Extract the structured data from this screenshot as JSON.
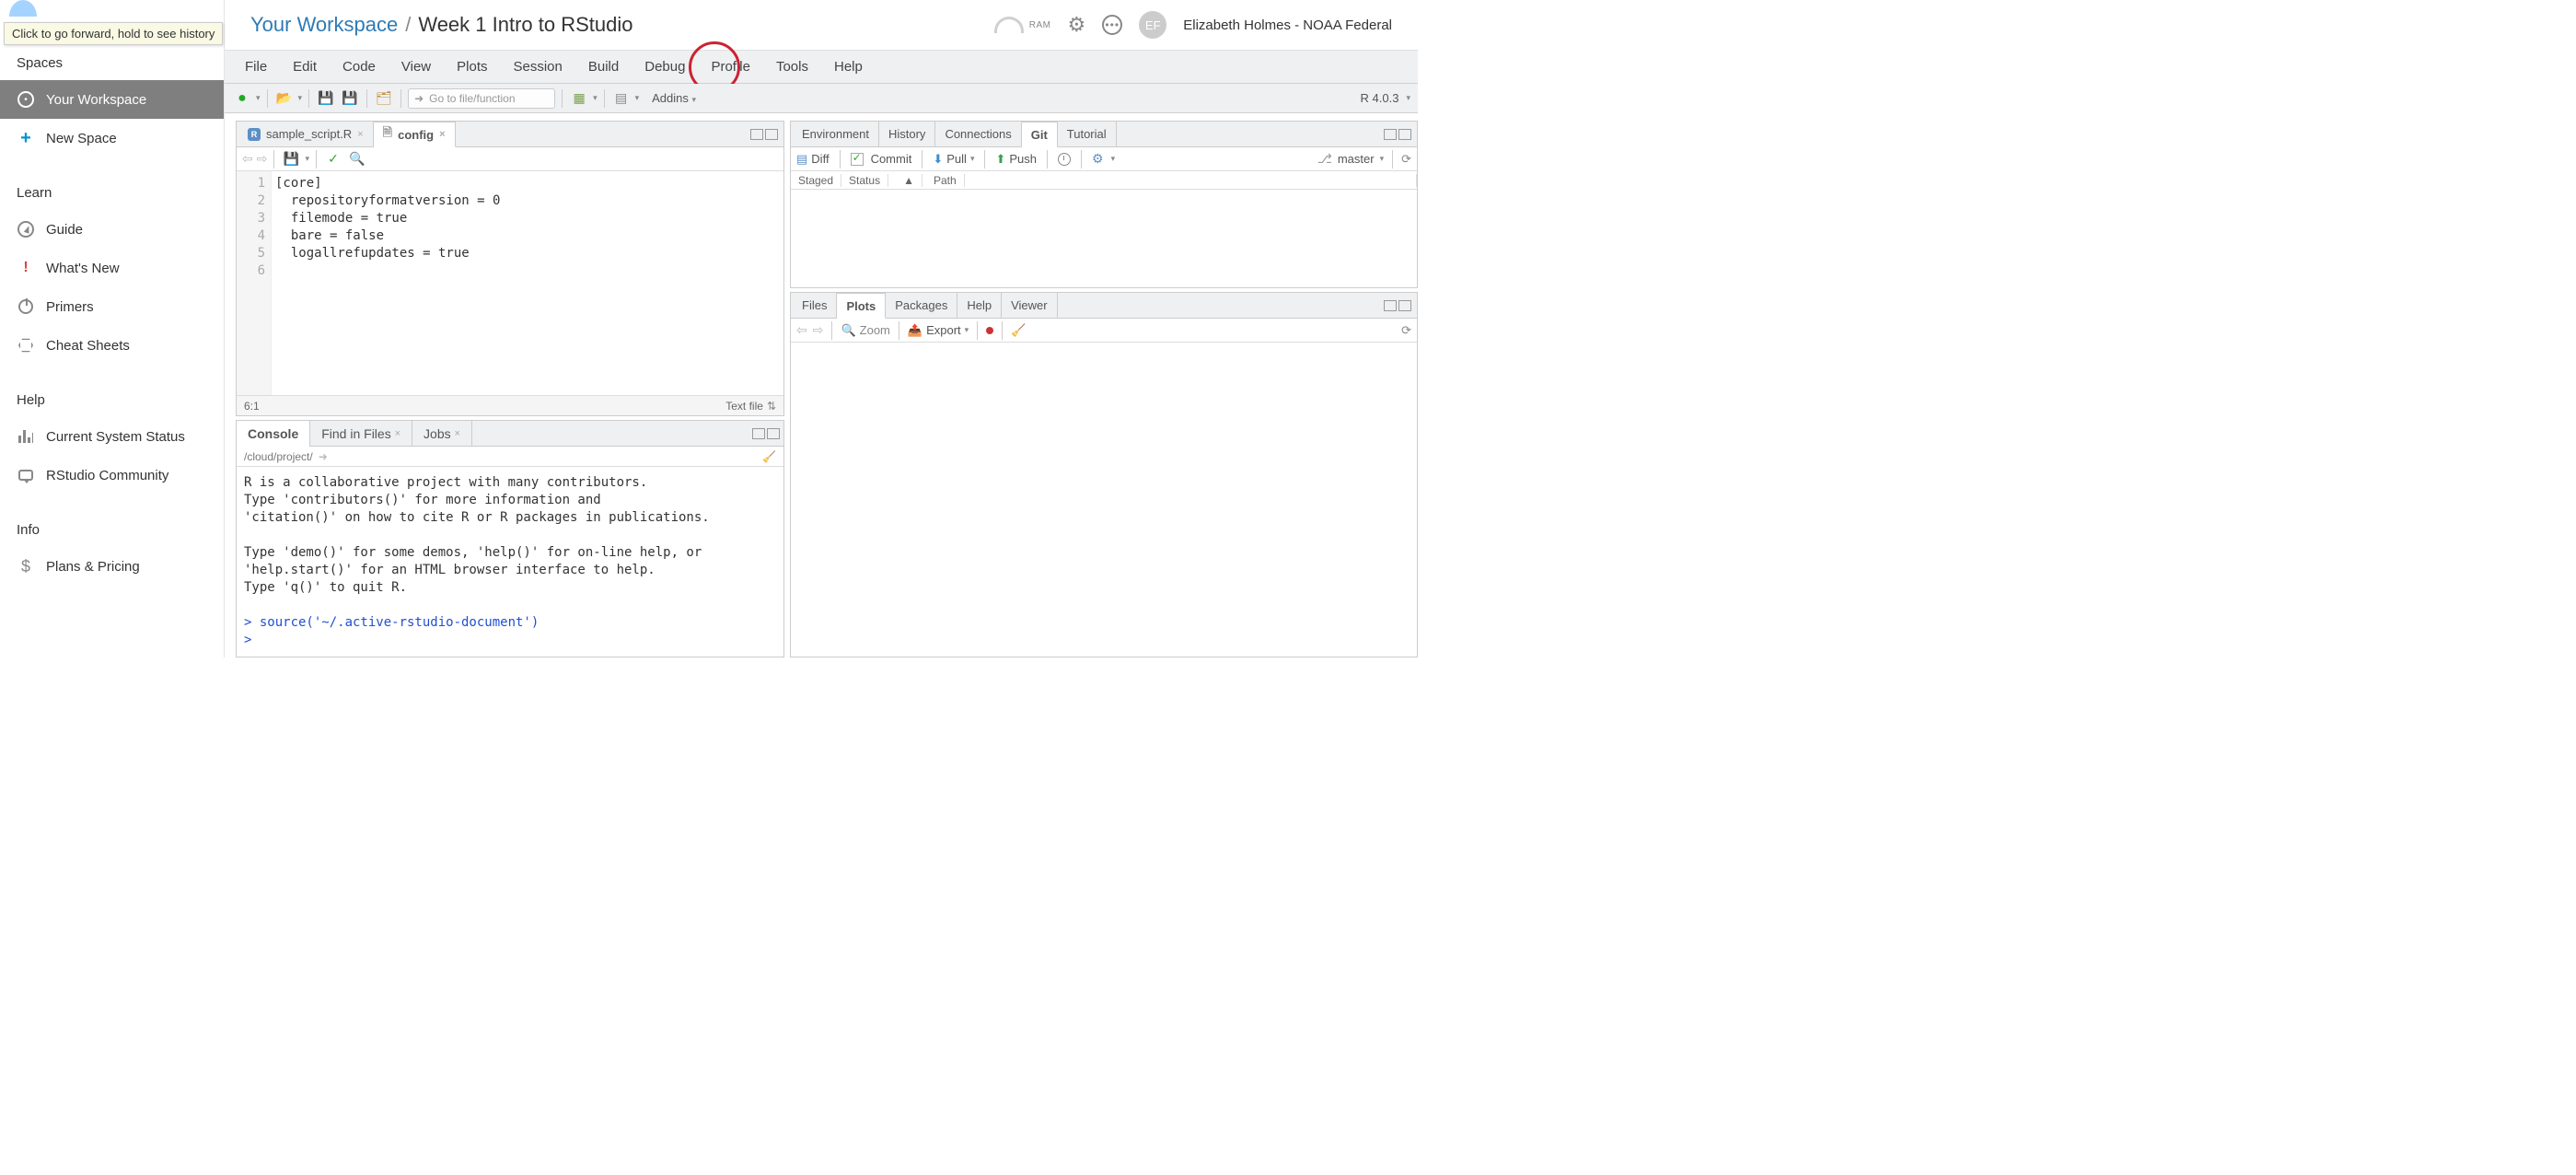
{
  "browser_tooltip": "Click to go forward, hold to see history",
  "sidebar": {
    "headings": {
      "spaces": "Spaces",
      "learn": "Learn",
      "help": "Help",
      "info": "Info"
    },
    "your_workspace": "Your Workspace",
    "new_space": "New Space",
    "guide": "Guide",
    "whats_new": "What's New",
    "primers": "Primers",
    "cheat_sheets": "Cheat Sheets",
    "system_status": "Current System Status",
    "community": "RStudio Community",
    "plans": "Plans & Pricing"
  },
  "breadcrumb": {
    "workspace": "Your Workspace",
    "project": "Week 1 Intro to RStudio"
  },
  "top_right": {
    "ram": "RAM",
    "user_initials": "EF",
    "user_name": "Elizabeth Holmes - NOAA Federal"
  },
  "menu": {
    "file": "File",
    "edit": "Edit",
    "code": "Code",
    "view": "View",
    "plots": "Plots",
    "session": "Session",
    "build": "Build",
    "debug": "Debug",
    "profile": "Profile",
    "tools": "Tools",
    "help": "Help"
  },
  "toolbar": {
    "goto_placeholder": "Go to file/function",
    "addins": "Addins",
    "r_version": "R 4.0.3"
  },
  "source": {
    "tabs": {
      "script": "sample_script.R",
      "config": "config"
    },
    "lines": [
      "1",
      "2",
      "3",
      "4",
      "5",
      "6"
    ],
    "code": "[core]\n  repositoryformatversion = 0\n  filemode = true\n  bare = false\n  logallrefupdates = true\n",
    "cursor": "6:1",
    "filetype": "Text file"
  },
  "console": {
    "tabs": {
      "console": "Console",
      "find": "Find in Files",
      "jobs": "Jobs"
    },
    "path": "/cloud/project/",
    "body_plain": "R is a collaborative project with many contributors.\nType 'contributors()' for more information and\n'citation()' on how to cite R or R packages in publications.\n\nType 'demo()' for some demos, 'help()' for on-line help, or\n'help.start()' for an HTML browser interface to help.\nType 'q()' to quit R.\n",
    "cmd": "> source('~/.active-rstudio-document')",
    "prompt": "> "
  },
  "env_pane": {
    "tabs": {
      "env": "Environment",
      "hist": "History",
      "conn": "Connections",
      "git": "Git",
      "tut": "Tutorial"
    },
    "git": {
      "diff": "Diff",
      "commit": "Commit",
      "pull": "Pull",
      "push": "Push",
      "branch": "master",
      "hdr_staged": "Staged",
      "hdr_status": "Status",
      "hdr_path": "Path"
    }
  },
  "plots_pane": {
    "tabs": {
      "files": "Files",
      "plots": "Plots",
      "packages": "Packages",
      "help": "Help",
      "viewer": "Viewer"
    },
    "zoom": "Zoom",
    "export": "Export"
  }
}
